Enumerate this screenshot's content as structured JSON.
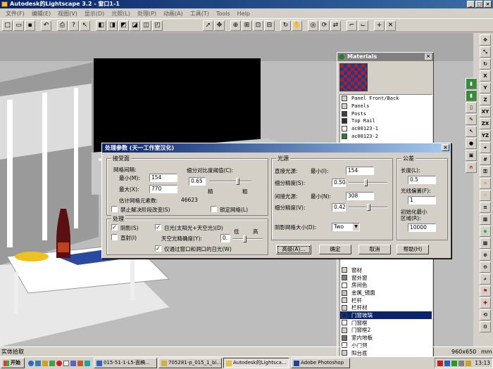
{
  "window": {
    "title": "Autodesk的Lightscape 3.2 - 窗口1-1"
  },
  "menu": [
    "文件(F)",
    "编辑(E)",
    "视图(V)",
    "显示(D)",
    "光照(L)",
    "处理(P)",
    "动画(A)",
    "工具(T)",
    "Tools",
    "Help"
  ],
  "materials": {
    "title": "Materials",
    "items": [
      {
        "label": "Panel Front/Back",
        "mono": true,
        "color": "#d4d0c8"
      },
      {
        "label": "Panels",
        "mono": true,
        "color": "#d4d0c8"
      },
      {
        "label": "Posts",
        "mono": true,
        "color": "#404040"
      },
      {
        "label": "Top Rail",
        "mono": true,
        "color": "#303030"
      },
      {
        "label": "ac00123-1",
        "mono": true,
        "color": "#ffffff"
      },
      {
        "label": "ac00123-2",
        "mono": true,
        "color": "#2e7d32"
      },
      {
        "label": "窗材",
        "mono": false,
        "color": "#d4d0c8"
      },
      {
        "label": "窗外窗",
        "mono": false,
        "color": "#808080"
      },
      {
        "label": "房间色",
        "mono": false,
        "color": "#ffffff"
      },
      {
        "label": "金属_镜面",
        "mono": false,
        "color": "#c0c0c0"
      },
      {
        "label": "栏杆",
        "mono": false,
        "color": "#d4d0c8"
      },
      {
        "label": "栏杆材",
        "mono": false,
        "color": "#d4d0c8"
      },
      {
        "label": "门窗玻璃",
        "mono": false,
        "color": "#0a246a",
        "selected": true
      },
      {
        "label": "门窗框",
        "mono": false,
        "color": "#ffffff"
      },
      {
        "label": "门窗框2",
        "mono": false,
        "color": "#d4d0c8"
      },
      {
        "label": "室内地板",
        "mono": false,
        "color": "#707070"
      },
      {
        "label": "小门洞",
        "mono": false,
        "color": "#ffffff"
      },
      {
        "label": "阳台底",
        "mono": false,
        "color": "#d4d0c8"
      }
    ]
  },
  "dialog": {
    "title": "处理参数 (天一工作室汉化)",
    "close": "×",
    "surface": {
      "label": "接受面",
      "mesh_spacing": "网格间隔:",
      "min_label": "最小(M):",
      "min_value": "154",
      "max_label": "最大(X):",
      "max_value": "770",
      "subdiv_label": "细分对比度阈值(C):",
      "subdiv_value": "0.65",
      "fine": "精",
      "coarse": "粗",
      "estimate_label": "估计网格元素数:",
      "estimate_value": "46623",
      "disable_label": "禁止解决阶段改变(S)",
      "lock_label": "锁定网格(L)"
    },
    "process": {
      "label": "处理",
      "shadow": "阴影(S)",
      "direct": "直射(I)",
      "daylight": "日光(太阳光+天空光)(D)",
      "sky_precision": "天空光精确度(Y):",
      "sky_value": "0.",
      "low": "低",
      "high": "高",
      "windows_only": "仅通过窗口和洞口的日光(W)"
    },
    "light": {
      "label": "光源",
      "direct_label": "直接光源:",
      "direct_min": "最小(I):",
      "direct_value": "154",
      "subdiv_label": "细分精度(S):",
      "subdiv_value": "0.50",
      "indirect_label": "间接光源:",
      "indirect_min": "最小(N):",
      "indirect_value": "308",
      "subdiv2_label": "细分精度(V):",
      "subdiv2_value": "0.42",
      "shadow_grid_label": "阴影网格大小(D):",
      "shadow_grid_value": "Two"
    },
    "common": {
      "label": "公差",
      "length_label": "长度(L):",
      "length_value": "0.5",
      "offset_label": "光线偏置(F):",
      "offset_value": "1",
      "init_label1": "初始化最小",
      "init_label2": "区域(R):",
      "init_value": "10000"
    },
    "buttons": {
      "preset": "高级(A)...",
      "ok": "确定",
      "cancel": "取消",
      "help": "帮助(H)"
    }
  },
  "status": {
    "left": "实体拾取",
    "size": "960x650",
    "unit": "mm"
  },
  "taskbar": {
    "start": "开始",
    "tasks": [
      "015-51-1-L5-面稿...",
      "705281-p_015_1_bi...",
      "Autodesk的Lightsca...",
      "Adobe Photoshop"
    ],
    "clock": "13:13"
  }
}
